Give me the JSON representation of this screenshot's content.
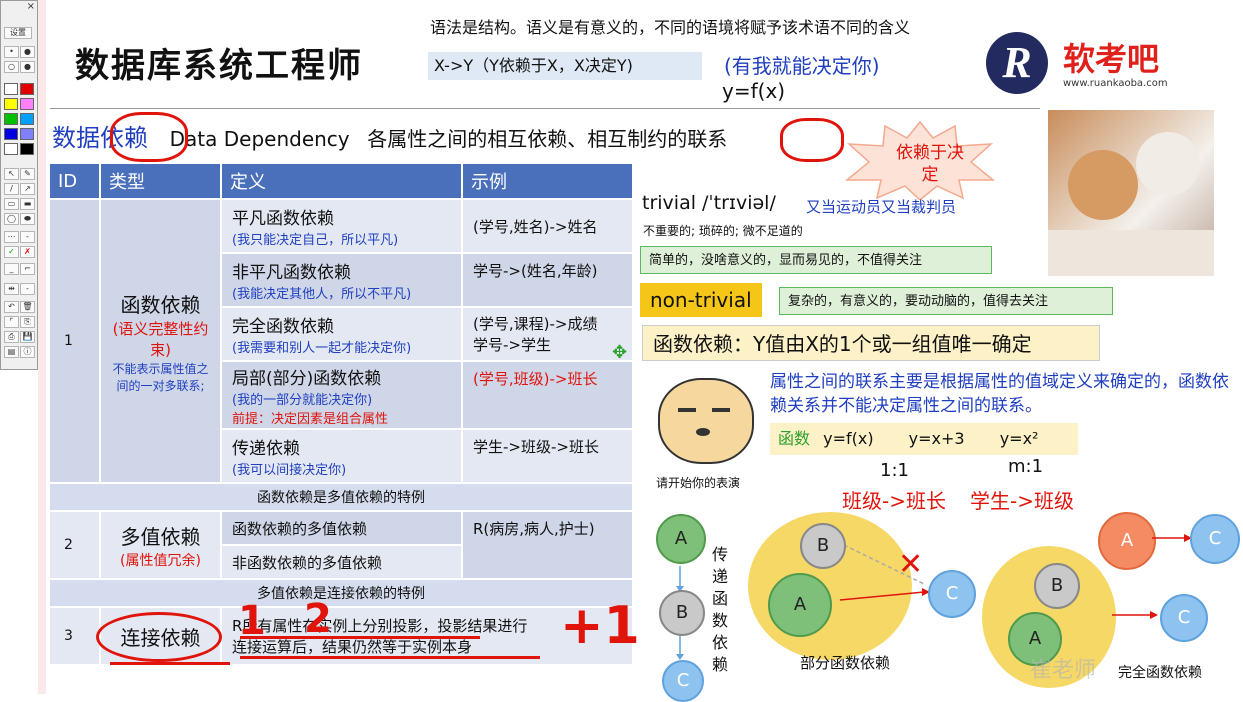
{
  "toolbar": {
    "close": "×",
    "btn_label": "设置"
  },
  "header": {
    "title": "数据库系统工程师",
    "note": "语法是结构。语义是有意义的，不同的语境将赋予该术语不同的含义",
    "xy_box": "X->Y（Y依赖于X，X决定Y)",
    "xy_comment": "(有我就能决定你)",
    "yfx": "y=f(x)"
  },
  "logo": {
    "mark": "R",
    "name": "软考吧",
    "url": "www.ruankaoba.com"
  },
  "section": {
    "title_a": "数据",
    "title_b": "依赖",
    "title_en": "Data Dependency",
    "title_rest": "各属性之间的相互依赖、相互制约的联系"
  },
  "table": {
    "headers": [
      "ID",
      "类型",
      "定义",
      "示例"
    ],
    "row1": {
      "id": "1",
      "type": "函数依赖",
      "type_note_red": "(语义完整性约束)",
      "type_note_blue": "不能表示属性值之间的一对多联系;",
      "items": [
        {
          "name": "平凡函数依赖",
          "desc": "(我只能决定自己，所以平凡)",
          "example": "(学号,姓名)->姓名"
        },
        {
          "name": "非平凡函数依赖",
          "desc": "(我能决定其他人，所以不平凡)",
          "example": "学号->(姓名,年龄)"
        },
        {
          "name": "完全函数依赖",
          "desc": "(我需要和别人一起才能决定你)",
          "example": "(学号,课程)->成绩\n学号->学生"
        },
        {
          "name": "局部(部分)函数依赖",
          "desc": "(我的一部分就能决定你)",
          "desc2": "前提：决定因素是组合属性",
          "example": "(学号,班级)->班长"
        },
        {
          "name": "传递依赖",
          "desc": "(我可以间接决定你)",
          "example": "学生->班级->班长"
        }
      ]
    },
    "span1": "函数依赖是多值依赖的特例",
    "row2": {
      "id": "2",
      "type": "多值依赖",
      "type_note": "(属性值冗余)",
      "items": [
        "函数依赖的多值依赖",
        "非函数依赖的多值依赖"
      ],
      "example": "R(病房,病人,护士)"
    },
    "span2": "多值依赖是连接依赖的特例",
    "row3": {
      "id": "3",
      "type": "连接依赖",
      "definition_1": "R所有属性在实例上分别投影，投影结果进行",
      "definition_2": "连接运算后，结果仍然等于实例本身"
    }
  },
  "right": {
    "starburst": "依赖于决定",
    "trivial_word": "trivial /ˈtrɪviəl/",
    "trivial_comment": "又当运动员又当裁判员",
    "trivial_def": "不重要的; 琐碎的; 微不足道的",
    "trivial_green": "简单的，没啥意义的，显而易见的，不值得关注",
    "nontrivial": "non-trivial",
    "nontrivial_green": "复杂的，有意义的，要动动脑的，值得去关注",
    "fd_def": "函数依赖：Y值由X的1个或一组值唯一确定",
    "fd_note": "属性之间的联系主要是根据属性的值域定义来确定的，函数依赖关系并不能决定属性之间的联系。",
    "func_label": "函数",
    "func_exprs": [
      "y=f(x)",
      "y=x+3",
      "y=x²"
    ],
    "ratio_11": "1:1",
    "ratio_m1": "m:1",
    "ex_red_1": "班级->班长",
    "ex_red_2": "学生->班级",
    "sticker_caption": "请开始你的表演",
    "chain_label": "传递函数依赖",
    "partial_label": "部分函数依赖",
    "full_label": "完全函数依赖",
    "watermark": "崔老师"
  },
  "nodes": {
    "a": "A",
    "b": "B",
    "c": "C"
  },
  "scribbles": {
    "one": "1",
    "two": "2",
    "plus": "+1"
  }
}
